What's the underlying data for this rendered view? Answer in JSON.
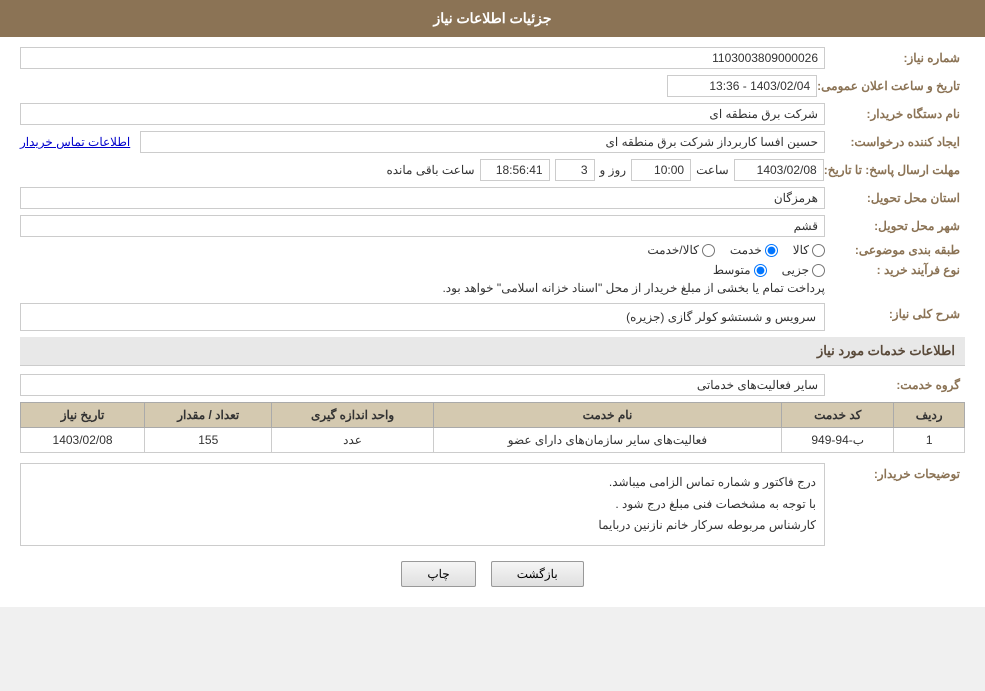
{
  "header": {
    "title": "جزئیات اطلاعات نیاز"
  },
  "form": {
    "need_number_label": "شماره نیاز:",
    "need_number_value": "1103003809000026",
    "buyer_org_label": "نام دستگاه خریدار:",
    "buyer_org_value": "",
    "date_label": "تاریخ و ساعت اعلان عمومی:",
    "date_value": "1403/02/04 - 13:36",
    "creator_label": "ایجاد کننده درخواست:",
    "creator_value": "حسین افسا کاربرداز شرکت برق منطقه ای",
    "contact_link": "اطلاعات تماس خریدار",
    "company_value": "شرکت برق منطقه ای",
    "response_deadline_label": "مهلت ارسال پاسخ: تا تاریخ:",
    "response_date": "1403/02/08",
    "response_time_label": "ساعت",
    "response_time": "10:00",
    "response_days_label": "روز و",
    "response_days": "3",
    "remaining_time_label": "ساعت باقی مانده",
    "remaining_time": "18:56:41",
    "delivery_province_label": "استان محل تحویل:",
    "delivery_province_value": "هرمزگان",
    "delivery_city_label": "شهر محل تحویل:",
    "delivery_city_value": "قشم",
    "category_label": "طبقه بندی موضوعی:",
    "category_options": [
      "کالا",
      "خدمت",
      "کالا/خدمت"
    ],
    "category_selected": "خدمت",
    "purchase_type_label": "نوع فرآیند خرید :",
    "purchase_type_notice": "پرداخت تمام یا بخشی از مبلغ خریدار از محل \"اسناد خزانه اسلامی\" خواهد بود.",
    "purchase_options": [
      "جزیی",
      "متوسط"
    ],
    "purchase_selected": "متوسط",
    "service_desc_label": "شرح کلی نیاز:",
    "service_desc_value": "سرویس و شستشو کولر گازی (جزیره)",
    "service_info_title": "اطلاعات خدمات مورد نیاز",
    "service_group_label": "گروه خدمت:",
    "service_group_value": "سایر فعالیت‌های خدماتی"
  },
  "table": {
    "columns": [
      "ردیف",
      "کد خدمت",
      "نام خدمت",
      "واحد اندازه گیری",
      "تعداد / مقدار",
      "تاریخ نیاز"
    ],
    "rows": [
      {
        "row_num": "1",
        "service_code": "ب-94-949",
        "service_name": "فعالیت‌های سایر سازمان‌های دارای عضو",
        "unit": "عدد",
        "quantity": "155",
        "date": "1403/02/08"
      }
    ]
  },
  "buyer_notes": {
    "label": "توضیحات خریدار:",
    "line1": "درج فاکتور و شماره تماس الزامی میباشد.",
    "line2": "با توجه به مشخصات فنی مبلغ درج شود .",
    "line3": "کارشناس مربوطه سرکار خانم نازنین دربایما"
  },
  "buttons": {
    "back_label": "بازگشت",
    "print_label": "چاپ"
  }
}
